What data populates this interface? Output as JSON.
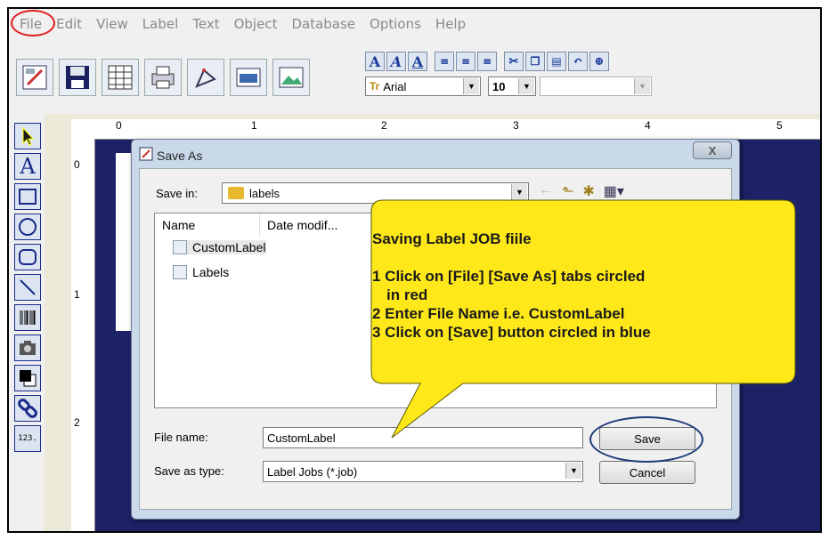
{
  "menu": [
    "File",
    "Edit",
    "View",
    "Label",
    "Text",
    "Object",
    "Database",
    "Options",
    "Help"
  ],
  "toolbar": {
    "font_name": "Arial",
    "font_size": "10",
    "font_glyph": "Tr",
    "bold_glyphs": [
      "A",
      "A",
      "A"
    ]
  },
  "ruler": {
    "h_ticks": [
      "0",
      "1",
      "2",
      "3",
      "4",
      "5"
    ],
    "v_ticks": [
      "0",
      "1",
      "2"
    ]
  },
  "dialog": {
    "title": "Save As",
    "close_label": "X",
    "save_in_label": "Save in:",
    "save_in_value": "labels",
    "columns": [
      "Name",
      "Date modif..."
    ],
    "files": [
      "CustomLabel",
      "Labels"
    ],
    "file_name_label": "File name:",
    "file_name_value": "CustomLabel",
    "file_type_label": "Save as type:",
    "file_type_value": "Label Jobs (*.job)",
    "save_button": "Save",
    "cancel_button": "Cancel"
  },
  "callout": {
    "title": "Saving Label JOB fiile",
    "lines": [
      "1 Click on [File] [Save As] tabs circled",
      "in red",
      "2 Enter File Name  i.e. CustomLabel",
      "3 Click on [Save] button circled in blue"
    ]
  },
  "tools": {
    "number_tool_label": "123."
  },
  "colors": {
    "canvas": "#1d2266",
    "callout_fill": "#ffe81a",
    "file_circle": "#e02020",
    "save_circle": "#1f3b7a"
  }
}
